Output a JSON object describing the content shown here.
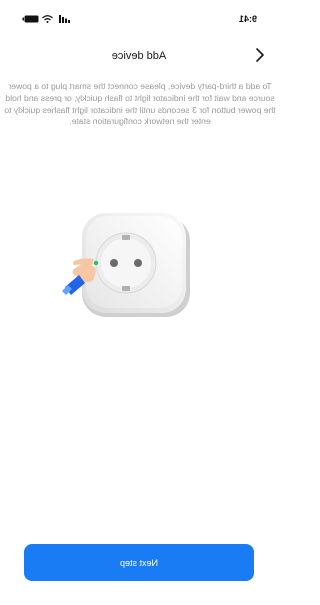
{
  "status_bar": {
    "time": "9:41"
  },
  "header": {
    "title": "Add device",
    "back_icon": "back-arrow-icon"
  },
  "instructions": {
    "text": "To add a third-party device, please connect the smart plug to a power source and wait for the indicator light to flash quickly, or press and hold the power button for 3 seconds until the indicator light flashes quickly to enter the network configuration state."
  },
  "illustration": {
    "description_icon": "smart-plug-illustration",
    "indicator_color": "#22c55e"
  },
  "footer": {
    "next_label": "Next step"
  },
  "colors": {
    "accent": "#1a7cf4",
    "text_secondary": "#9a9a9a"
  }
}
